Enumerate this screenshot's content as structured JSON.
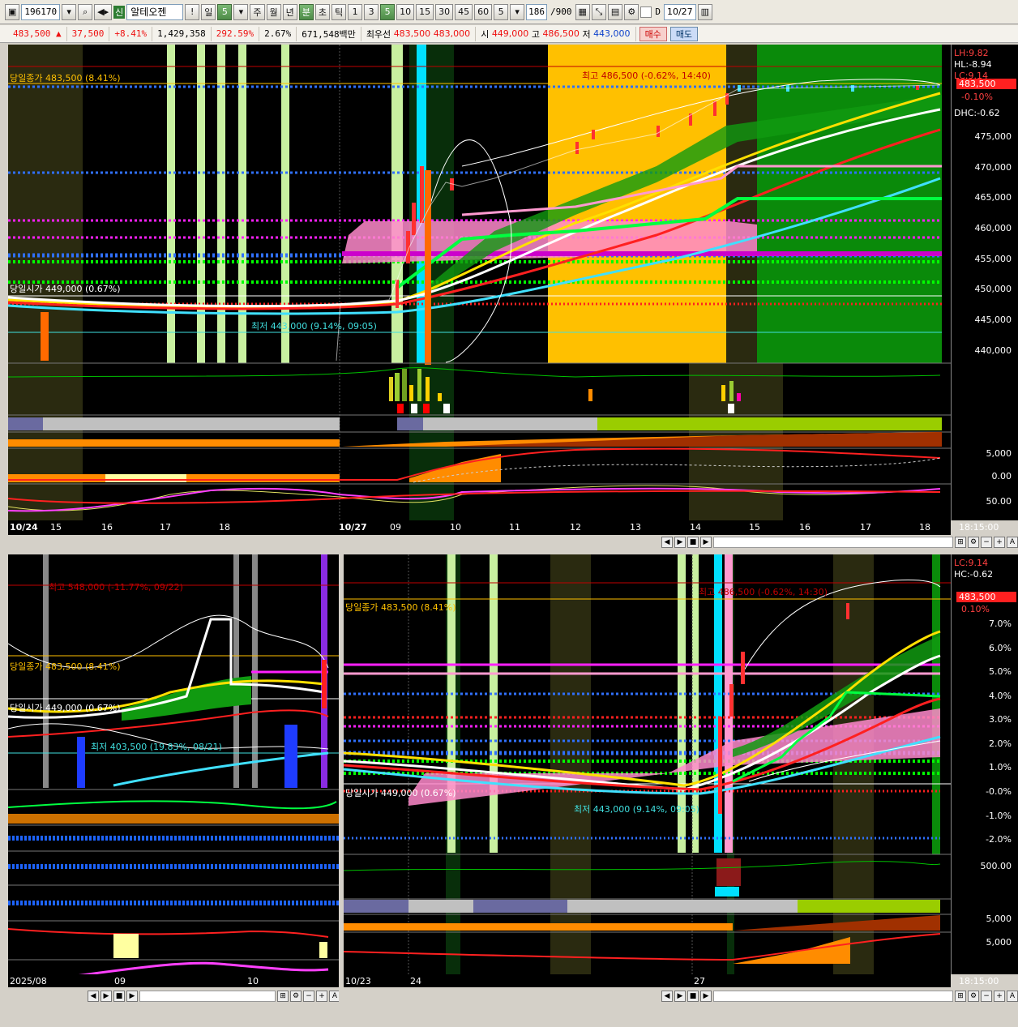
{
  "toolbar": {
    "code": "196170",
    "credit_badge": "신",
    "stock_name": "알테오젠",
    "period_buttons": [
      "일",
      "5",
      "주",
      "월",
      "년",
      "분",
      "초",
      "틱"
    ],
    "interval_buttons": [
      "1",
      "3",
      "5",
      "10",
      "15",
      "30",
      "45",
      "60"
    ],
    "interval_value": "5",
    "count": "186",
    "count_total": "/900",
    "date": "10/27",
    "date_prefix": "D"
  },
  "quote": {
    "price": "483,500",
    "arrow": "▲",
    "change": "37,500",
    "change_pct": "+8.41%",
    "volume": "1,429,358",
    "vol_ratio": "292.59%",
    "turnover_pct": "2.67%",
    "amount": "671,548백만",
    "best_ask_label": "최우선",
    "best_ask": "483,500",
    "best_bid": "483,000",
    "open_label": "시",
    "open": "449,000",
    "high_label": "고",
    "high": "486,500",
    "low_label": "저",
    "low": "443,000",
    "buy_label": "매수",
    "sell_label": "매도"
  },
  "main_chart": {
    "prev_close_label": "당일종가 483,500 (8.41%)",
    "high_label": "최고 486,500 (-0.62%, 14:40)",
    "low_label": "최저 443,000 (9.14%, 09:05)",
    "open_label": "당일시가 449,000 (0.67%)",
    "price_tag": "483,500",
    "price_tag_pct": "-0.10%",
    "side_labels": [
      "LH:9.82",
      "HL:-8.94",
      "LC:9.14",
      "DHC:-0.62"
    ],
    "yticks": [
      "475,000",
      "470,000",
      "465,000",
      "460,000",
      "455,000",
      "450,000",
      "445,000",
      "440,000"
    ],
    "sub_yticks": [
      "5,000",
      "0.00",
      "50.00"
    ],
    "xticks": [
      "10/24",
      "15",
      "16",
      "17",
      "18",
      "10/27",
      "09",
      "10",
      "11",
      "12",
      "13",
      "14",
      "15",
      "16",
      "17",
      "18"
    ],
    "clock": "18:15:00"
  },
  "left_chart": {
    "high_label": "최고 548,000 (-11.77%, 09/22)",
    "close_label": "당일종가 483,500 (8.41%)",
    "open_label": "당일시가 449,000 (0.67%)",
    "low_label": "최저 403,500 (19.83%, 08/21)",
    "xticks": [
      "2025/08",
      "09",
      "10"
    ]
  },
  "right_chart": {
    "high_label": "최고 486,500 (-0.62%, 14:30)",
    "close_label": "당일종가 483,500 (8.41%)",
    "open_label": "당일시가 449,000 (0.67%)",
    "low_label": "최저 443,000 (9.14%, 09:05)",
    "side_labels": [
      "LC:9.14",
      "HC:-0.62"
    ],
    "price_tag": "483,500",
    "price_tag_pct": "0.10%",
    "yticks": [
      "7.0%",
      "6.0%",
      "5.0%",
      "4.0%",
      "3.0%",
      "2.0%",
      "1.0%",
      "-0.0%",
      "-1.0%",
      "-2.0%"
    ],
    "sub_yticks": [
      "500.00",
      "5,000",
      "5,000"
    ],
    "xticks": [
      "10/23",
      "24",
      "27"
    ],
    "clock": "18:15:00"
  },
  "colors": {
    "up": "#ff2020",
    "down": "#1e64ff",
    "accent_green": "#00a000",
    "highlight_yellow": "#ffc000"
  }
}
